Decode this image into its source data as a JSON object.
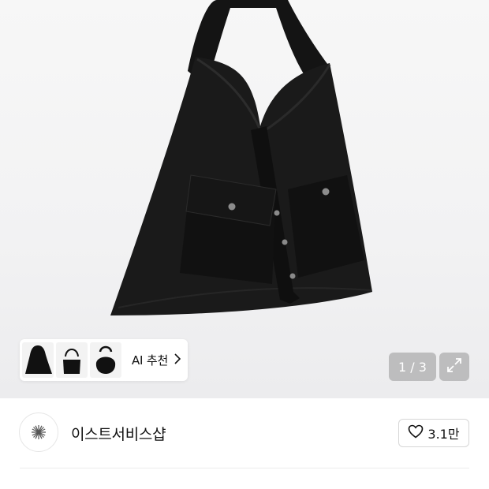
{
  "gallery": {
    "counter": "1 / 3",
    "ai_recommend_label": "AI 추천",
    "thumbnails": [
      "bag-thumb-1",
      "bag-thumb-2",
      "bag-thumb-3"
    ]
  },
  "seller": {
    "name": "이스트서비스샵",
    "like_count": "3.1만"
  },
  "icons": {
    "expand": "expand-icon",
    "heart": "heart-icon",
    "chevron": "chevron-right-icon"
  }
}
